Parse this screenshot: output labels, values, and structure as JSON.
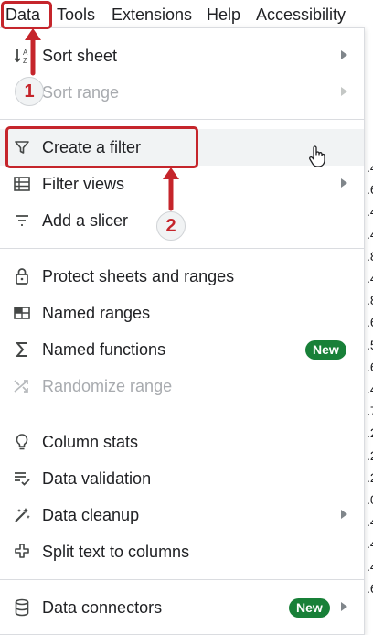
{
  "menubar": {
    "items": [
      "Data",
      "Tools",
      "Extensions",
      "Help",
      "Accessibility"
    ]
  },
  "menu": {
    "sort_sheet": "Sort sheet",
    "sort_range": "Sort range",
    "create_filter": "Create a filter",
    "filter_views": "Filter views",
    "add_slicer": "Add a slicer",
    "protect": "Protect sheets and ranges",
    "named_ranges": "Named ranges",
    "named_functions": "Named functions",
    "randomize": "Randomize range",
    "column_stats": "Column stats",
    "data_validation": "Data validation",
    "data_cleanup": "Data cleanup",
    "split_text": "Split text to columns",
    "data_connectors": "Data connectors",
    "new_badge": "New"
  },
  "annotations": {
    "step1": "1",
    "step2": "2"
  },
  "sheet_fragments": [
    ".4",
    ".6",
    ".4",
    ".4",
    ".8",
    ".4",
    ".8",
    ".6",
    ".5",
    ".6",
    ".4",
    ".7",
    ".2",
    ".2",
    ".2",
    ".0",
    ".4",
    ".4",
    ".4",
    ".6"
  ],
  "colors": {
    "annotation_red": "#c5252b",
    "new_badge": "#188038",
    "hover": "#f1f3f4"
  }
}
